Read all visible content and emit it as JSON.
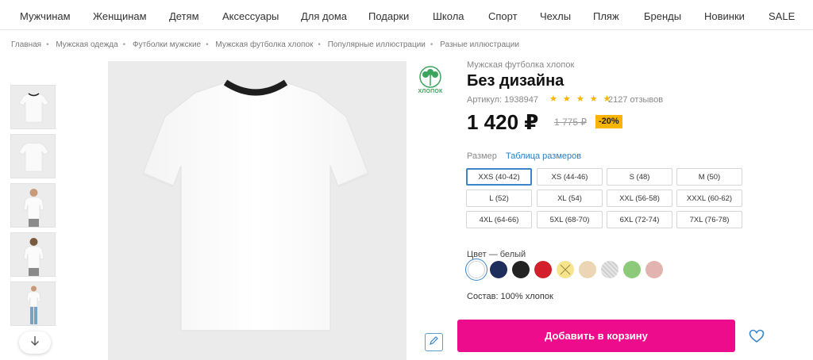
{
  "nav": {
    "items": [
      "Мужчинам",
      "Женщинам",
      "Детям",
      "Аксессуары",
      "Для дома",
      "Подарки",
      "Школа",
      "Спорт",
      "Чехлы",
      "Пляж",
      "Бренды",
      "Новинки",
      "SALE"
    ]
  },
  "breadcrumb": [
    "Главная",
    "Мужская одежда",
    "Футболки мужские",
    "Мужская футболка хлопок",
    "Популярные иллюстрации",
    "Разные иллюстрации"
  ],
  "badge": {
    "label": "ХЛОПОК",
    "color": "#3ba55c"
  },
  "product": {
    "category": "Мужская футболка хлопок",
    "title": "Без дизайна",
    "article": "Артикул: 1938947",
    "rating_stars": "★ ★ ★ ★ ★",
    "rating": 5,
    "reviews": "2127 отзывов",
    "price": "1 420 ₽",
    "old_price": "1 775 ₽",
    "discount": "-20%",
    "size_label": "Размер",
    "size_table_link": "Таблица размеров",
    "sizes": [
      "XXS (40-42)",
      "XS (44-46)",
      "S (48)",
      "M (50)",
      "L (52)",
      "XL (54)",
      "XXL (56-58)",
      "XXXL (60-62)",
      "4XL (64-66)",
      "5XL (68-70)",
      "6XL (72-74)",
      "7XL (76-78)"
    ],
    "selected_size": "XXS (40-42)",
    "color_label": "Цвет — белый",
    "colors": [
      "#ffffff",
      "#1f2f5c",
      "#222222",
      "#d21f2b",
      "#f6e58d",
      "#ecd5b4",
      "#d0d0d0",
      "#8cc97a",
      "#e2b3b0"
    ],
    "composition": "Состав: 100% хлопок",
    "add_to_cart": "Добавить в корзину",
    "accent_color": "#ec0c8c"
  },
  "icons": {
    "scroll_down": "arrow-down-icon",
    "edit": "pencil-icon",
    "favorite": "heart-icon",
    "cotton": "cotton-icon"
  }
}
